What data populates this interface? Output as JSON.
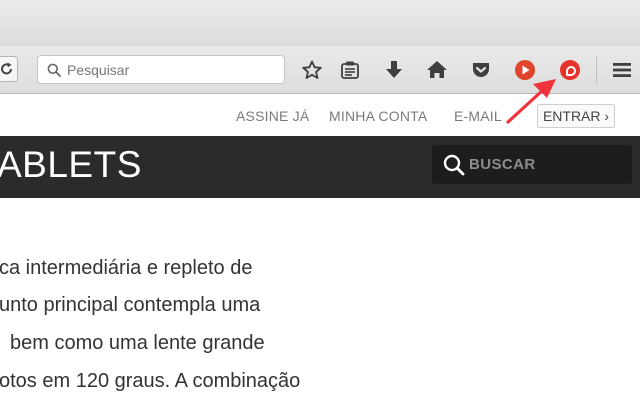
{
  "browser": {
    "search": {
      "placeholder": "Pesquisar"
    }
  },
  "site": {
    "topnav": {
      "subscribe": "ASSINE JÁ",
      "account": "MINHA CONTA",
      "email": "E-MAIL",
      "login": "ENTRAR ›"
    },
    "section_title": "ABLETS",
    "search_label": "BUSCAR"
  },
  "article": {
    "lines": [
      "ca intermediária e repleto de",
      "unto principal contempla uma",
      "bem como uma lente grande",
      "otos em 120 graus. A combinação"
    ]
  },
  "colors": {
    "play_red": "#e0452c",
    "extension_red": "#e8322c",
    "arrow_red": "#f0323c",
    "brandbar": "#2b2b2b"
  }
}
